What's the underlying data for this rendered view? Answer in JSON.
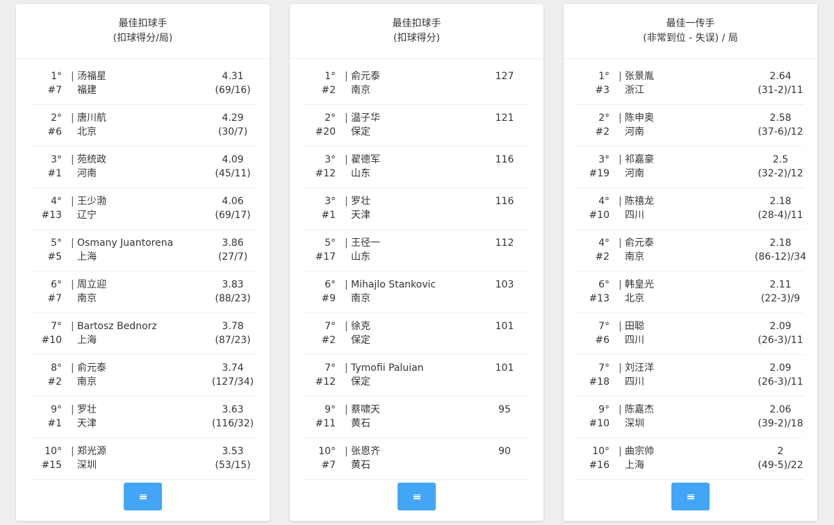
{
  "colors": {
    "button": "#42a5f5",
    "card": "#ffffff",
    "background": "#eeeeee"
  },
  "separator": "|",
  "more_button_icon": "menu-lines-icon",
  "cards": [
    {
      "title_line1": "最佳扣球手",
      "title_line2": "(扣球得分/局)",
      "rows": [
        {
          "rank": "1°",
          "number": "#7",
          "name": "汤福星",
          "team": "福建",
          "value": "4.31",
          "detail": "(69/16)"
        },
        {
          "rank": "2°",
          "number": "#6",
          "name": "唐川航",
          "team": "北京",
          "value": "4.29",
          "detail": "(30/7)"
        },
        {
          "rank": "3°",
          "number": "#1",
          "name": "苑统政",
          "team": "河南",
          "value": "4.09",
          "detail": "(45/11)"
        },
        {
          "rank": "4°",
          "number": "#13",
          "name": "王少渤",
          "team": "辽宁",
          "value": "4.06",
          "detail": "(69/17)"
        },
        {
          "rank": "5°",
          "number": "#5",
          "name": "Osmany Juantorena",
          "team": "上海",
          "value": "3.86",
          "detail": "(27/7)"
        },
        {
          "rank": "6°",
          "number": "#7",
          "name": "周立迎",
          "team": "南京",
          "value": "3.83",
          "detail": "(88/23)"
        },
        {
          "rank": "7°",
          "number": "#10",
          "name": "Bartosz Bednorz",
          "team": "上海",
          "value": "3.78",
          "detail": "(87/23)"
        },
        {
          "rank": "8°",
          "number": "#2",
          "name": "俞元泰",
          "team": "南京",
          "value": "3.74",
          "detail": "(127/34)"
        },
        {
          "rank": "9°",
          "number": "#1",
          "name": "罗壮",
          "team": "天津",
          "value": "3.63",
          "detail": "(116/32)"
        },
        {
          "rank": "10°",
          "number": "#15",
          "name": "郑光源",
          "team": "深圳",
          "value": "3.53",
          "detail": "(53/15)"
        }
      ]
    },
    {
      "title_line1": "最佳扣球手",
      "title_line2": "(扣球得分)",
      "rows": [
        {
          "rank": "1°",
          "number": "#2",
          "name": "俞元泰",
          "team": "南京",
          "value": "127",
          "detail": ""
        },
        {
          "rank": "2°",
          "number": "#20",
          "name": "温子华",
          "team": "保定",
          "value": "121",
          "detail": ""
        },
        {
          "rank": "3°",
          "number": "#12",
          "name": "翟德军",
          "team": "山东",
          "value": "116",
          "detail": ""
        },
        {
          "rank": "3°",
          "number": "#1",
          "name": "罗壮",
          "team": "天津",
          "value": "116",
          "detail": ""
        },
        {
          "rank": "5°",
          "number": "#17",
          "name": "王径一",
          "team": "山东",
          "value": "112",
          "detail": ""
        },
        {
          "rank": "6°",
          "number": "#9",
          "name": "Mihajlo Stankovic",
          "team": "南京",
          "value": "103",
          "detail": ""
        },
        {
          "rank": "7°",
          "number": "#2",
          "name": "徐克",
          "team": "保定",
          "value": "101",
          "detail": ""
        },
        {
          "rank": "7°",
          "number": "#12",
          "name": "Tymofii Paluian",
          "team": "保定",
          "value": "101",
          "detail": ""
        },
        {
          "rank": "9°",
          "number": "#11",
          "name": "蔡啸天",
          "team": "黄石",
          "value": "95",
          "detail": ""
        },
        {
          "rank": "10°",
          "number": "#7",
          "name": "张恩齐",
          "team": "黄石",
          "value": "90",
          "detail": ""
        }
      ]
    },
    {
      "title_line1": "最佳一传手",
      "title_line2": "(非常到位 - 失误) / 局",
      "rows": [
        {
          "rank": "1°",
          "number": "#3",
          "name": "张景胤",
          "team": "浙江",
          "value": "2.64",
          "detail": "(31-2)/11"
        },
        {
          "rank": "2°",
          "number": "#2",
          "name": "陈申奥",
          "team": "河南",
          "value": "2.58",
          "detail": "(37-6)/12"
        },
        {
          "rank": "3°",
          "number": "#19",
          "name": "祁嘉豪",
          "team": "河南",
          "value": "2.5",
          "detail": "(32-2)/12"
        },
        {
          "rank": "4°",
          "number": "#10",
          "name": "陈禧龙",
          "team": "四川",
          "value": "2.18",
          "detail": "(28-4)/11"
        },
        {
          "rank": "4°",
          "number": "#2",
          "name": "俞元泰",
          "team": "南京",
          "value": "2.18",
          "detail": "(86-12)/34"
        },
        {
          "rank": "6°",
          "number": "#13",
          "name": "韩皇光",
          "team": "北京",
          "value": "2.11",
          "detail": "(22-3)/9"
        },
        {
          "rank": "7°",
          "number": "#6",
          "name": "田聪",
          "team": "四川",
          "value": "2.09",
          "detail": "(26-3)/11"
        },
        {
          "rank": "7°",
          "number": "#18",
          "name": "刘汪洋",
          "team": "四川",
          "value": "2.09",
          "detail": "(26-3)/11"
        },
        {
          "rank": "9°",
          "number": "#10",
          "name": "陈嘉杰",
          "team": "深圳",
          "value": "2.06",
          "detail": "(39-2)/18"
        },
        {
          "rank": "10°",
          "number": "#16",
          "name": "曲宗帅",
          "team": "上海",
          "value": "2",
          "detail": "(49-5)/22"
        }
      ]
    }
  ]
}
